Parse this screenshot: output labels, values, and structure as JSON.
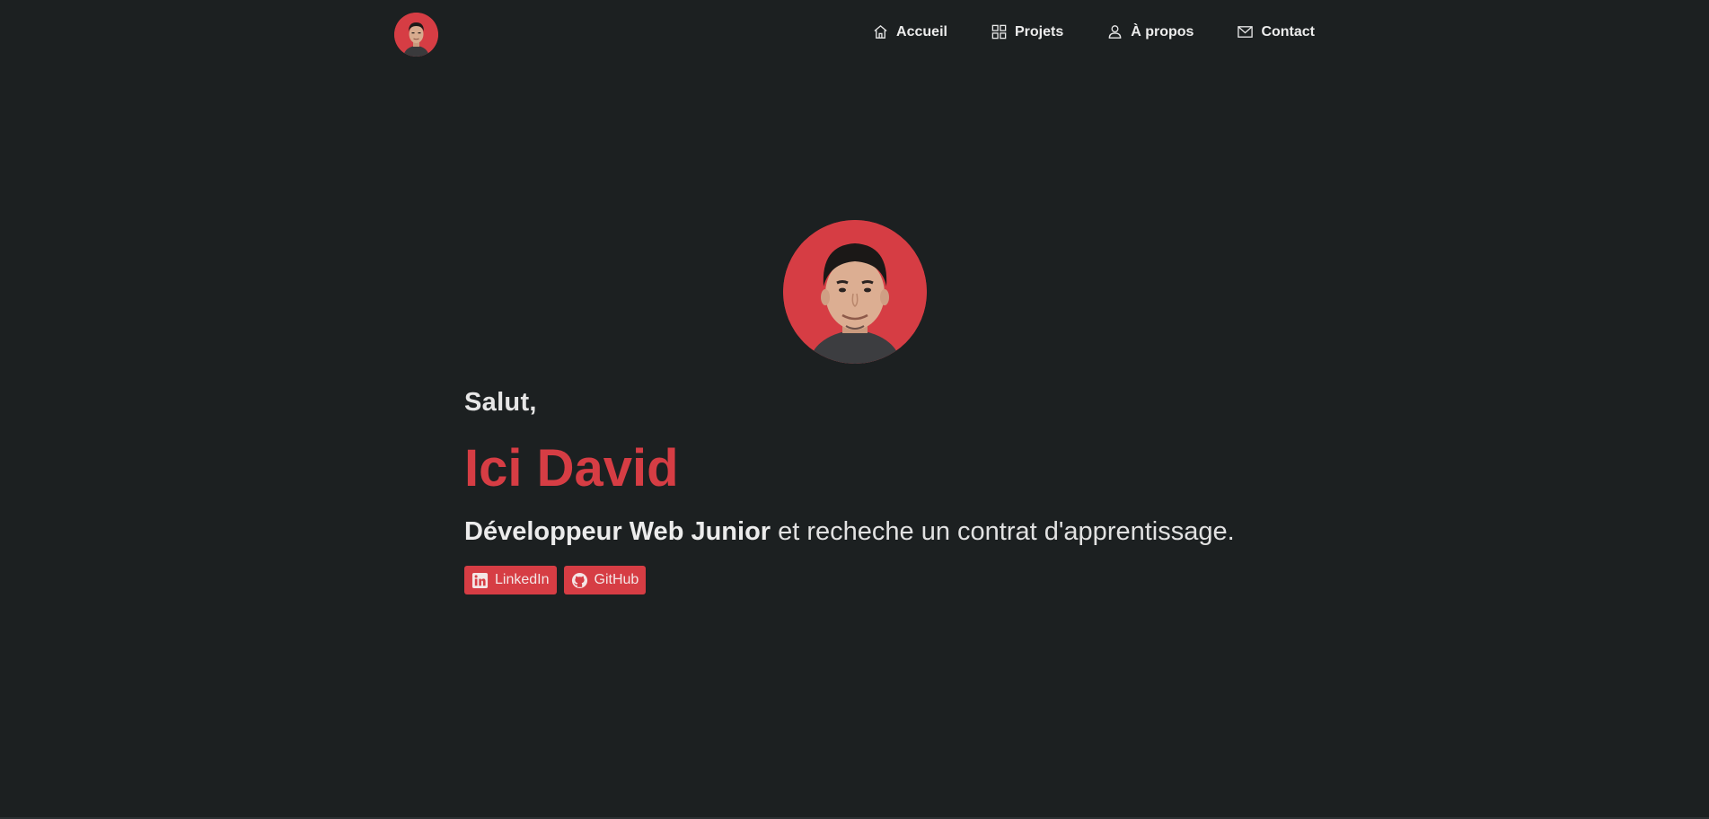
{
  "nav": {
    "brand_alt": "David",
    "items": [
      {
        "label": "Accueil",
        "icon": "home-icon"
      },
      {
        "label": "Projets",
        "icon": "grid-icon"
      },
      {
        "label": "À propos",
        "icon": "user-icon"
      },
      {
        "label": "Contact",
        "icon": "mail-icon"
      }
    ]
  },
  "hero": {
    "greeting": "Salut,",
    "name": "Ici David",
    "role": "Développeur Web Junior",
    "tagline_rest": " et recheche un contrat d'apprentissage.",
    "socials": [
      {
        "label": "LinkedIn",
        "icon": "linkedin-icon"
      },
      {
        "label": "GitHub",
        "icon": "github-icon"
      }
    ]
  },
  "colors": {
    "background": "#1c2021",
    "accent": "#d63d44",
    "text": "#e2e2e2"
  }
}
